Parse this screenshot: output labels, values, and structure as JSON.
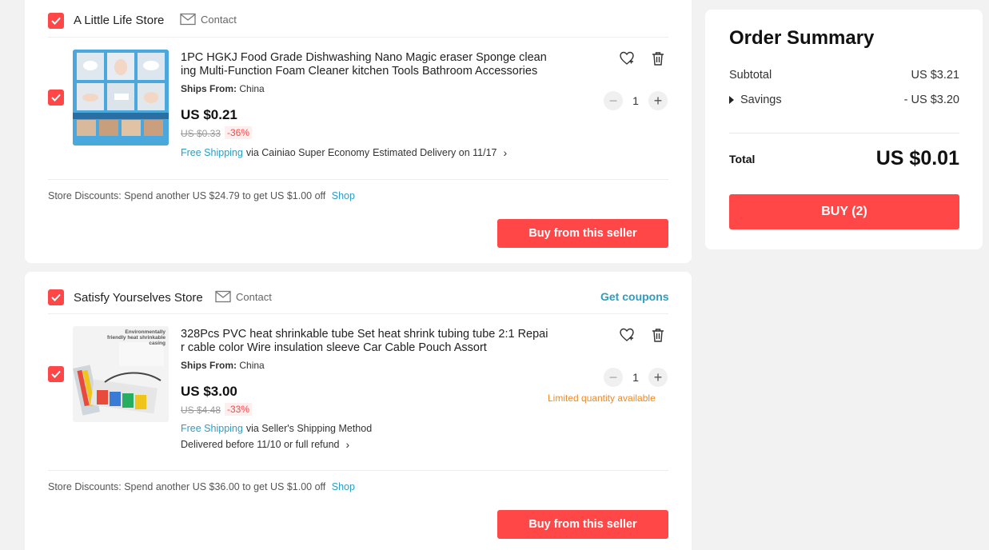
{
  "stores": [
    {
      "name": "A Little Life Store",
      "contact_label": "Contact",
      "item": {
        "title": "1PC HGKJ Food Grade Dishwashing Nano Magic eraser Sponge cleaning Multi-Function Foam Cleaner kitchen Tools Bathroom Accessories",
        "ships_from_label": "Ships From:",
        "ships_from": "China",
        "price": "US $0.21",
        "original_price": "US $0.33",
        "discount": "-36%",
        "free_shipping": "Free Shipping",
        "shipping_method": "via Cainiao Super Economy",
        "delivery": "Estimated Delivery on 11/17",
        "quantity": "1"
      },
      "store_discount_label": "Store Discounts:",
      "store_discount_text": "Spend another US $24.79 to get US $1.00 off",
      "shop_link": "Shop",
      "buy_label": "Buy from this seller"
    },
    {
      "name": "Satisfy Yourselves Store",
      "contact_label": "Contact",
      "coupons_label": "Get coupons",
      "item": {
        "title": "328Pcs PVC heat shrinkable tube Set heat shrink tubing tube 2:1 Repair cable color Wire insulation sleeve Car Cable Pouch Assort",
        "image_caption": "Environmentally friendly heat shrinkable casing",
        "ships_from_label": "Ships From:",
        "ships_from": "China",
        "price": "US $3.00",
        "original_price": "US $4.48",
        "discount": "-33%",
        "free_shipping": "Free Shipping",
        "shipping_method": "via Seller's Shipping Method",
        "delivery": "Delivered before 11/10 or full refund",
        "quantity": "1",
        "limited": "Limited quantity available"
      },
      "store_discount_label": "Store Discounts:",
      "store_discount_text": "Spend another US $36.00 to get US $1.00 off",
      "shop_link": "Shop",
      "buy_label": "Buy from this seller"
    }
  ],
  "summary": {
    "title": "Order Summary",
    "subtotal_label": "Subtotal",
    "subtotal": "US $3.21",
    "savings_label": "Savings",
    "savings": "- US $3.20",
    "total_label": "Total",
    "total": "US $0.01",
    "buy_label": "BUY (2)"
  },
  "colors": {
    "accent": "#ff4747",
    "link": "#2e9cc3",
    "warning": "#f08a24",
    "background": "#f2f2f2"
  },
  "icons": [
    "checkbox-checked-icon",
    "mail-icon",
    "heart-plus-icon",
    "trash-icon",
    "minus-icon",
    "plus-icon",
    "chevron-right-icon",
    "caret-right-icon"
  ]
}
